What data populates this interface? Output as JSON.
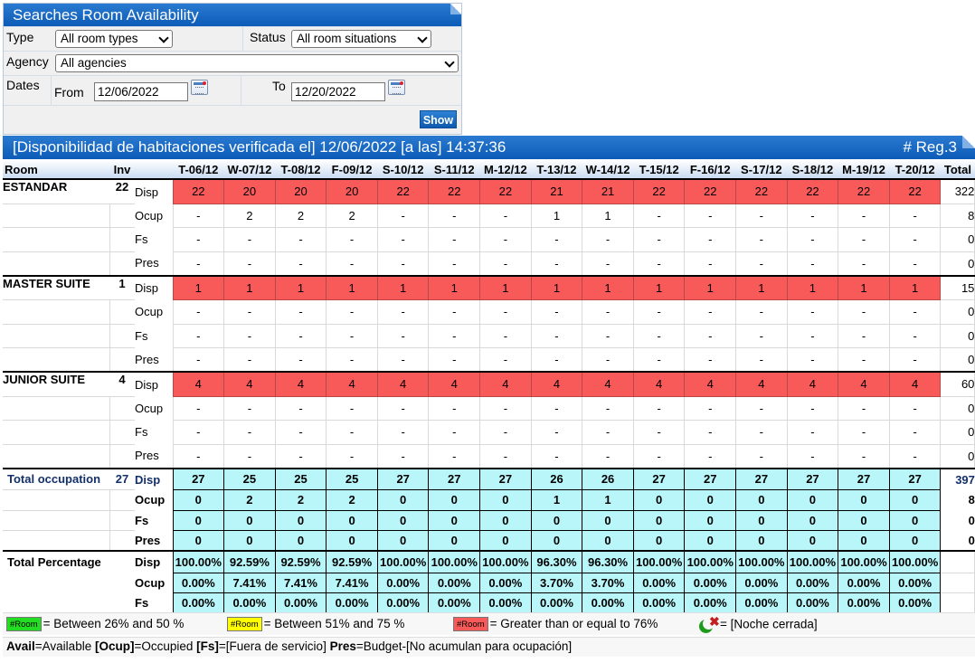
{
  "panel": {
    "title": "Searches Room Availability",
    "type_label": "Type",
    "type_value": "All room types",
    "status_label": "Status",
    "status_value": "All room situations",
    "agency_label": "Agency",
    "agency_value": "All agencies",
    "dates_label": "Dates",
    "from_label": "From",
    "from_value": "12/06/2022",
    "to_label": "To",
    "to_value": "12/20/2022",
    "show_button": "Show",
    "calendar_icon": "calendar-icon"
  },
  "results": {
    "title": "[Disponibilidad de habitaciones verificada el] 12/06/2022 [a las] 14:37:36",
    "reg": "# Reg.3",
    "columns": {
      "room": "Room",
      "inv": "Inv",
      "total": "Total",
      "dates": [
        "T-06/12",
        "W-07/12",
        "T-08/12",
        "F-09/12",
        "S-10/12",
        "S-11/12",
        "M-12/12",
        "T-13/12",
        "W-14/12",
        "T-15/12",
        "F-16/12",
        "S-17/12",
        "S-18/12",
        "M-19/12",
        "T-20/12"
      ]
    },
    "rooms": [
      {
        "name": "ESTANDAR",
        "inv": "22",
        "rows": [
          {
            "label": "Disp",
            "values": [
              "22",
              "20",
              "20",
              "20",
              "22",
              "22",
              "22",
              "21",
              "21",
              "22",
              "22",
              "22",
              "22",
              "22",
              "22"
            ],
            "total": "322"
          },
          {
            "label": "Ocup",
            "values": [
              "-",
              "2",
              "2",
              "2",
              "-",
              "-",
              "-",
              "1",
              "1",
              "-",
              "-",
              "-",
              "-",
              "-",
              "-"
            ],
            "total": "8"
          },
          {
            "label": "Fs",
            "values": [
              "-",
              "-",
              "-",
              "-",
              "-",
              "-",
              "-",
              "-",
              "-",
              "-",
              "-",
              "-",
              "-",
              "-",
              "-"
            ],
            "total": "0"
          },
          {
            "label": "Pres",
            "values": [
              "-",
              "-",
              "-",
              "-",
              "-",
              "-",
              "-",
              "-",
              "-",
              "-",
              "-",
              "-",
              "-",
              "-",
              "-"
            ],
            "total": "0"
          }
        ]
      },
      {
        "name": "MASTER SUITE",
        "inv": "1",
        "rows": [
          {
            "label": "Disp",
            "values": [
              "1",
              "1",
              "1",
              "1",
              "1",
              "1",
              "1",
              "1",
              "1",
              "1",
              "1",
              "1",
              "1",
              "1",
              "1"
            ],
            "total": "15"
          },
          {
            "label": "Ocup",
            "values": [
              "-",
              "-",
              "-",
              "-",
              "-",
              "-",
              "-",
              "-",
              "-",
              "-",
              "-",
              "-",
              "-",
              "-",
              "-"
            ],
            "total": "0"
          },
          {
            "label": "Fs",
            "values": [
              "-",
              "-",
              "-",
              "-",
              "-",
              "-",
              "-",
              "-",
              "-",
              "-",
              "-",
              "-",
              "-",
              "-",
              "-"
            ],
            "total": "0"
          },
          {
            "label": "Pres",
            "values": [
              "-",
              "-",
              "-",
              "-",
              "-",
              "-",
              "-",
              "-",
              "-",
              "-",
              "-",
              "-",
              "-",
              "-",
              "-"
            ],
            "total": "0"
          }
        ]
      },
      {
        "name": "JUNIOR SUITE",
        "inv": "4",
        "rows": [
          {
            "label": "Disp",
            "values": [
              "4",
              "4",
              "4",
              "4",
              "4",
              "4",
              "4",
              "4",
              "4",
              "4",
              "4",
              "4",
              "4",
              "4",
              "4"
            ],
            "total": "60"
          },
          {
            "label": "Ocup",
            "values": [
              "-",
              "-",
              "-",
              "-",
              "-",
              "-",
              "-",
              "-",
              "-",
              "-",
              "-",
              "-",
              "-",
              "-",
              "-"
            ],
            "total": "0"
          },
          {
            "label": "Fs",
            "values": [
              "-",
              "-",
              "-",
              "-",
              "-",
              "-",
              "-",
              "-",
              "-",
              "-",
              "-",
              "-",
              "-",
              "-",
              "-"
            ],
            "total": "0"
          },
          {
            "label": "Pres",
            "values": [
              "-",
              "-",
              "-",
              "-",
              "-",
              "-",
              "-",
              "-",
              "-",
              "-",
              "-",
              "-",
              "-",
              "-",
              "-"
            ],
            "total": "0"
          }
        ]
      }
    ],
    "total_occupation": {
      "label": "Total occupation",
      "inv": "27",
      "rows": [
        {
          "label": "Disp",
          "values": [
            "27",
            "25",
            "25",
            "25",
            "27",
            "27",
            "27",
            "26",
            "26",
            "27",
            "27",
            "27",
            "27",
            "27",
            "27"
          ],
          "total": "397"
        },
        {
          "label": "Ocup",
          "values": [
            "0",
            "2",
            "2",
            "2",
            "0",
            "0",
            "0",
            "1",
            "1",
            "0",
            "0",
            "0",
            "0",
            "0",
            "0"
          ],
          "total": "8"
        },
        {
          "label": "Fs",
          "values": [
            "0",
            "0",
            "0",
            "0",
            "0",
            "0",
            "0",
            "0",
            "0",
            "0",
            "0",
            "0",
            "0",
            "0",
            "0"
          ],
          "total": "0"
        },
        {
          "label": "Pres",
          "values": [
            "0",
            "0",
            "0",
            "0",
            "0",
            "0",
            "0",
            "0",
            "0",
            "0",
            "0",
            "0",
            "0",
            "0",
            "0"
          ],
          "total": "0"
        }
      ]
    },
    "total_percentage": {
      "label": "Total Percentage",
      "rows": [
        {
          "label": "Disp",
          "values": [
            "100.00%",
            "92.59%",
            "92.59%",
            "92.59%",
            "100.00%",
            "100.00%",
            "100.00%",
            "96.30%",
            "96.30%",
            "100.00%",
            "100.00%",
            "100.00%",
            "100.00%",
            "100.00%",
            "100.00%"
          ]
        },
        {
          "label": "Ocup",
          "values": [
            "0.00%",
            "7.41%",
            "7.41%",
            "7.41%",
            "0.00%",
            "0.00%",
            "0.00%",
            "3.70%",
            "3.70%",
            "0.00%",
            "0.00%",
            "0.00%",
            "0.00%",
            "0.00%",
            "0.00%"
          ]
        },
        {
          "label": "Fs",
          "values": [
            "0.00%",
            "0.00%",
            "0.00%",
            "0.00%",
            "0.00%",
            "0.00%",
            "0.00%",
            "0.00%",
            "0.00%",
            "0.00%",
            "0.00%",
            "0.00%",
            "0.00%",
            "0.00%",
            "0.00%"
          ]
        }
      ]
    }
  },
  "legend": {
    "green_chip": "#Room",
    "green_text": "= Between 26% and 50 %",
    "yellow_chip": "#Room",
    "yellow_text": "= Between 51% and 75 %",
    "red_chip": "#Room",
    "red_text": "= Greater than or equal to 76%",
    "night_icon": "closed-night-icon",
    "night_text": "= [Noche cerrada]"
  },
  "footer": {
    "k1": "Avail",
    "t1": "=Available ",
    "k2": "[Ocup]",
    "t2": "=Occupied ",
    "k3": "[Fs]",
    "t3": "=[Fuera de servicio] ",
    "k4": "Pres",
    "t4": "=Budget-[No acumulan para ocupación]"
  },
  "colors": {
    "header_blue": "#0c5cb8",
    "avail_red": "#f85a5a",
    "total_cyan": "#b9f6f9",
    "green_chip": "#22dd22",
    "yellow_chip": "#ffff00",
    "red_chip": "#f85a5a"
  }
}
